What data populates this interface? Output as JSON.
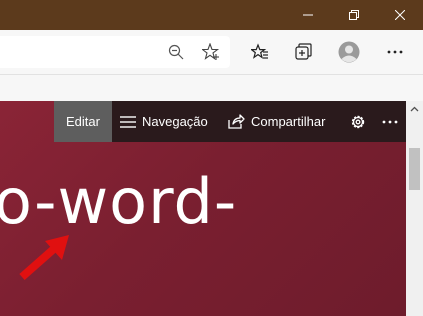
{
  "site_bar": {
    "edit_label": "Editar",
    "nav_label": "Navegação",
    "share_label": "Compartilhar"
  },
  "page": {
    "headline": "o-word-"
  },
  "icons": {
    "minimize": "minimize-icon",
    "restore": "restore-icon",
    "close": "close-icon",
    "zoom_out": "zoom-out-icon",
    "favorite": "star-add-icon",
    "favorites": "favorites-icon",
    "collections": "collections-icon",
    "profile": "avatar-icon",
    "more": "more-icon",
    "hamburger": "hamburger-icon",
    "share": "share-icon",
    "settings": "gear-icon",
    "annotation": "red-arrow-icon"
  },
  "colors": {
    "titlebar": "#5c3a1c",
    "sitebar": "#2a1a1c",
    "edit_highlight": "#5e5e5e",
    "page_background": "#7a1f30",
    "annotation_arrow": "#e01010"
  }
}
